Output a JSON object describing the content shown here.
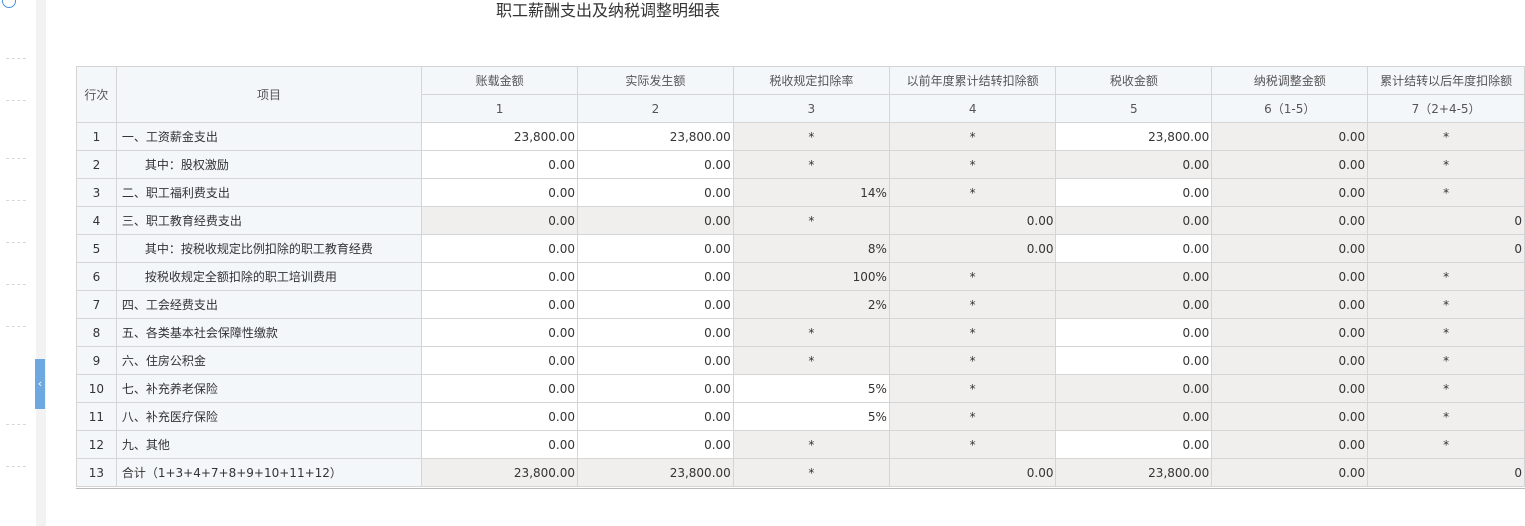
{
  "title": "职工薪酬支出及纳税调整明细表",
  "header": {
    "row_col": "行次",
    "item_col": "项目",
    "columns": [
      {
        "label": "账载金额",
        "index": "1"
      },
      {
        "label": "实际发生额",
        "index": "2"
      },
      {
        "label": "税收规定扣除率",
        "index": "3"
      },
      {
        "label": "以前年度累计结转扣除额",
        "index": "4"
      },
      {
        "label": "税收金额",
        "index": "5"
      },
      {
        "label": "纳税调整金额",
        "index": "6（1-5）"
      },
      {
        "label": "累计结转以后年度扣除额",
        "index": "7（2+4-5）"
      }
    ]
  },
  "rows": [
    {
      "seq": "1",
      "item": "一、工资薪金支出",
      "indent": false,
      "cells": [
        "23,800.00",
        "23,800.00",
        "*",
        "*",
        "23,800.00",
        "0.00",
        "*"
      ],
      "shade": [
        "w",
        "w",
        "g",
        "g",
        "w",
        "g",
        "g"
      ]
    },
    {
      "seq": "2",
      "item": "其中：股权激励",
      "indent": true,
      "cells": [
        "0.00",
        "0.00",
        "*",
        "*",
        "0.00",
        "0.00",
        "*"
      ],
      "shade": [
        "w",
        "w",
        "g",
        "g",
        "g",
        "g",
        "g"
      ]
    },
    {
      "seq": "3",
      "item": "二、职工福利费支出",
      "indent": false,
      "cells": [
        "0.00",
        "0.00",
        "14%",
        "*",
        "0.00",
        "0.00",
        "*"
      ],
      "shade": [
        "w",
        "w",
        "g",
        "g",
        "w",
        "g",
        "g"
      ]
    },
    {
      "seq": "4",
      "item": "三、职工教育经费支出",
      "indent": false,
      "cells": [
        "0.00",
        "0.00",
        "*",
        "0.00",
        "0.00",
        "0.00",
        "0"
      ],
      "shade": [
        "g",
        "g",
        "g",
        "g",
        "g",
        "g",
        "g"
      ]
    },
    {
      "seq": "5",
      "item": "其中：按税收规定比例扣除的职工教育经费",
      "indent": true,
      "cells": [
        "0.00",
        "0.00",
        "8%",
        "0.00",
        "0.00",
        "0.00",
        "0"
      ],
      "shade": [
        "w",
        "w",
        "g",
        "g",
        "w",
        "g",
        "g"
      ]
    },
    {
      "seq": "6",
      "item": "按税收规定全额扣除的职工培训费用",
      "indent": true,
      "cells": [
        "0.00",
        "0.00",
        "100%",
        "*",
        "0.00",
        "0.00",
        "*"
      ],
      "shade": [
        "w",
        "w",
        "g",
        "g",
        "g",
        "g",
        "g"
      ]
    },
    {
      "seq": "7",
      "item": "四、工会经费支出",
      "indent": false,
      "cells": [
        "0.00",
        "0.00",
        "2%",
        "*",
        "0.00",
        "0.00",
        "*"
      ],
      "shade": [
        "w",
        "w",
        "g",
        "g",
        "g",
        "g",
        "g"
      ]
    },
    {
      "seq": "8",
      "item": "五、各类基本社会保障性缴款",
      "indent": false,
      "cells": [
        "0.00",
        "0.00",
        "*",
        "*",
        "0.00",
        "0.00",
        "*"
      ],
      "shade": [
        "w",
        "w",
        "g",
        "g",
        "w",
        "g",
        "g"
      ]
    },
    {
      "seq": "9",
      "item": "六、住房公积金",
      "indent": false,
      "cells": [
        "0.00",
        "0.00",
        "*",
        "*",
        "0.00",
        "0.00",
        "*"
      ],
      "shade": [
        "w",
        "w",
        "g",
        "g",
        "w",
        "g",
        "g"
      ]
    },
    {
      "seq": "10",
      "item": "七、补充养老保险",
      "indent": false,
      "cells": [
        "0.00",
        "0.00",
        "5%",
        "*",
        "0.00",
        "0.00",
        "*"
      ],
      "shade": [
        "w",
        "w",
        "w",
        "g",
        "g",
        "g",
        "g"
      ]
    },
    {
      "seq": "11",
      "item": "八、补充医疗保险",
      "indent": false,
      "cells": [
        "0.00",
        "0.00",
        "5%",
        "*",
        "0.00",
        "0.00",
        "*"
      ],
      "shade": [
        "w",
        "w",
        "w",
        "g",
        "g",
        "g",
        "g"
      ]
    },
    {
      "seq": "12",
      "item": "九、其他",
      "indent": false,
      "cells": [
        "0.00",
        "0.00",
        "*",
        "*",
        "0.00",
        "0.00",
        "*"
      ],
      "shade": [
        "w",
        "w",
        "g",
        "g",
        "w",
        "g",
        "g"
      ]
    },
    {
      "seq": "13",
      "item": "合计（1+3+4+7+8+9+10+11+12）",
      "indent": false,
      "cells": [
        "23,800.00",
        "23,800.00",
        "*",
        "0.00",
        "23,800.00",
        "0.00",
        "0"
      ],
      "shade": [
        "g",
        "g",
        "g",
        "g",
        "g",
        "g",
        "g"
      ]
    }
  ],
  "collapse_glyph": "‹"
}
